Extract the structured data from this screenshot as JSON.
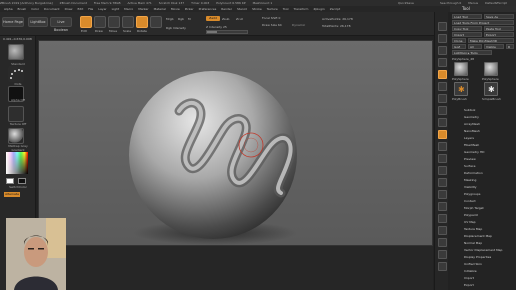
{
  "titlebar": {
    "title": "ZBrush 2019 [Anthony Burgabrina]",
    "doc": "ZBrush Document",
    "free_mem": "Free Mem 9.78GB",
    "active_mem": "Active Mem 471",
    "scratch": "Scratch Disk 137",
    "timer": "Timer 0.003",
    "polycount": "PolyCount 6.586 KP",
    "mesh_count": "MeshCount 1",
    "quicksave": "QuickSave",
    "see_through": "See-through 0",
    "menus": "Menus",
    "script": "DefaultZScript"
  },
  "menubar": {
    "items": [
      "Alpha",
      "Brush",
      "Color",
      "Document",
      "Draw",
      "Edit",
      "File",
      "Layer",
      "Light",
      "Macro",
      "Marker",
      "Material",
      "Movie",
      "Picker",
      "Preferences",
      "Render",
      "Stencil",
      "Stroke",
      "Texture",
      "Tool",
      "Transform",
      "Zplugin",
      "Zscript"
    ]
  },
  "toolbar": {
    "home_page": "Home Page",
    "lightbox": "LightBox",
    "live_boolean": "Live Boolean",
    "edit": "Edit",
    "draw": "Draw",
    "move": "Move",
    "scale": "Scale",
    "rotate": "Rotate",
    "mrgb": "Mrgb",
    "rgb": "Rgb",
    "m": "M",
    "zadd": "Zadd",
    "zsub": "Zsub",
    "zcut": "Zcut",
    "rgb_intensity": "Rgb Intensity",
    "z_intensity": "Z Intensity 25",
    "focal_shift": "Focal Shift 0",
    "draw_size": "Draw Size 64",
    "dynamic": "Dynamic",
    "active_points": "ActivePoints: 26,178",
    "total_points": "TotalPoints: 26,178",
    "coords": "0.491,-0.676,0.008",
    "z_intensity_level": 0.25
  },
  "left_panel": {
    "brush_label": "Standard",
    "stroke_label": "Dots",
    "alpha_label": "Alpha Off",
    "texture_label": "Texture Off",
    "material_label": "MatCap Gray",
    "gradient": "Gradient",
    "switch_color": "SwitchColor",
    "alternate": "Alternate"
  },
  "right_strip": {
    "items": [
      "BPR",
      "SPix 3",
      "Scroll",
      "Zoom",
      "Actual",
      "AAHalf",
      "Dynamic",
      "Persp",
      "Floor",
      "Local",
      "Gxyz",
      "Frame",
      "Move",
      "Zoom3D",
      "Rotate",
      "Line Fill",
      "PolyF",
      "Transp",
      "Ghost",
      "Solo",
      "Xpose"
    ]
  },
  "tool_panel": {
    "header": "Tool",
    "load_tool": "Load Tool",
    "save_as": "Save As",
    "load_tools_project": "Load Tools From Project",
    "copy_tool": "Copy Tool",
    "paste_tool": "Paste Tool",
    "import": "Import",
    "export": "Export",
    "clone": "Clone",
    "make_polymesh": "Make PolyMesh3D",
    "goz": "GoZ",
    "all": "All",
    "visible": "Visible",
    "r": "R",
    "lightbox_tools": "Lightbox ▸ Tools",
    "current_tool": "PolySphere_48",
    "thumbs": [
      "PolySphere",
      "PolySphere",
      "PolyBrush",
      "SimpleBrush"
    ],
    "menus": [
      "Subtool",
      "Geometry",
      "ArrayMesh",
      "NanoMesh",
      "Layers",
      "FiberMesh",
      "Geometry HD",
      "Preview",
      "Surface",
      "Deformation",
      "Masking",
      "Visibility",
      "Polygroups",
      "Contact",
      "Morph Target",
      "Polypaint",
      "UV Map",
      "Texture Map",
      "Displacement Map",
      "Normal Map",
      "Vector Displacement Map",
      "Display Properties",
      "Unified Skin",
      "Initialize",
      "Import",
      "Export"
    ]
  }
}
